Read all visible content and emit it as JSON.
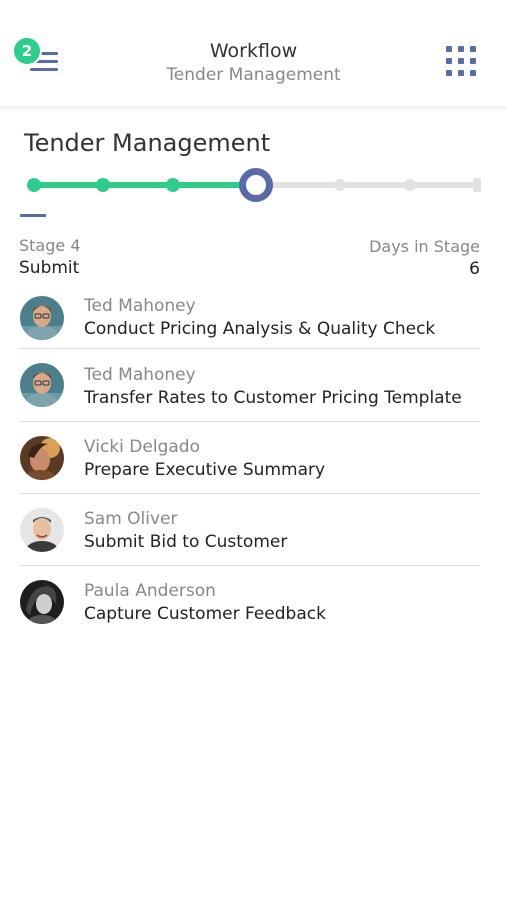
{
  "header": {
    "title": "Workflow",
    "subtitle": "Tender Management",
    "notification_count": "2",
    "menu_icon": "hamburger-menu-icon",
    "apps_icon": "grid-apps-icon"
  },
  "page": {
    "title": "Tender Management"
  },
  "stepper": {
    "total_steps": 7,
    "current_step": 4,
    "colors": {
      "done": "#2ecc8b",
      "current": "#5a6aa8",
      "todo": "#e2e2e2"
    }
  },
  "stage": {
    "label": "Stage 4",
    "name": "Submit",
    "days_label": "Days in Stage",
    "days_value": "6"
  },
  "tasks": [
    {
      "assignee": "Ted Mahoney",
      "title": "Conduct Pricing Analysis & Quality Check"
    },
    {
      "assignee": "Ted Mahoney",
      "title": "Transfer Rates to Customer Pricing Template"
    },
    {
      "assignee": "Vicki Delgado",
      "title": "Prepare Executive Summary"
    },
    {
      "assignee": "Sam Oliver",
      "title": "Submit Bid to Customer"
    },
    {
      "assignee": "Paula Anderson",
      "title": "Capture Customer Feedback"
    }
  ]
}
